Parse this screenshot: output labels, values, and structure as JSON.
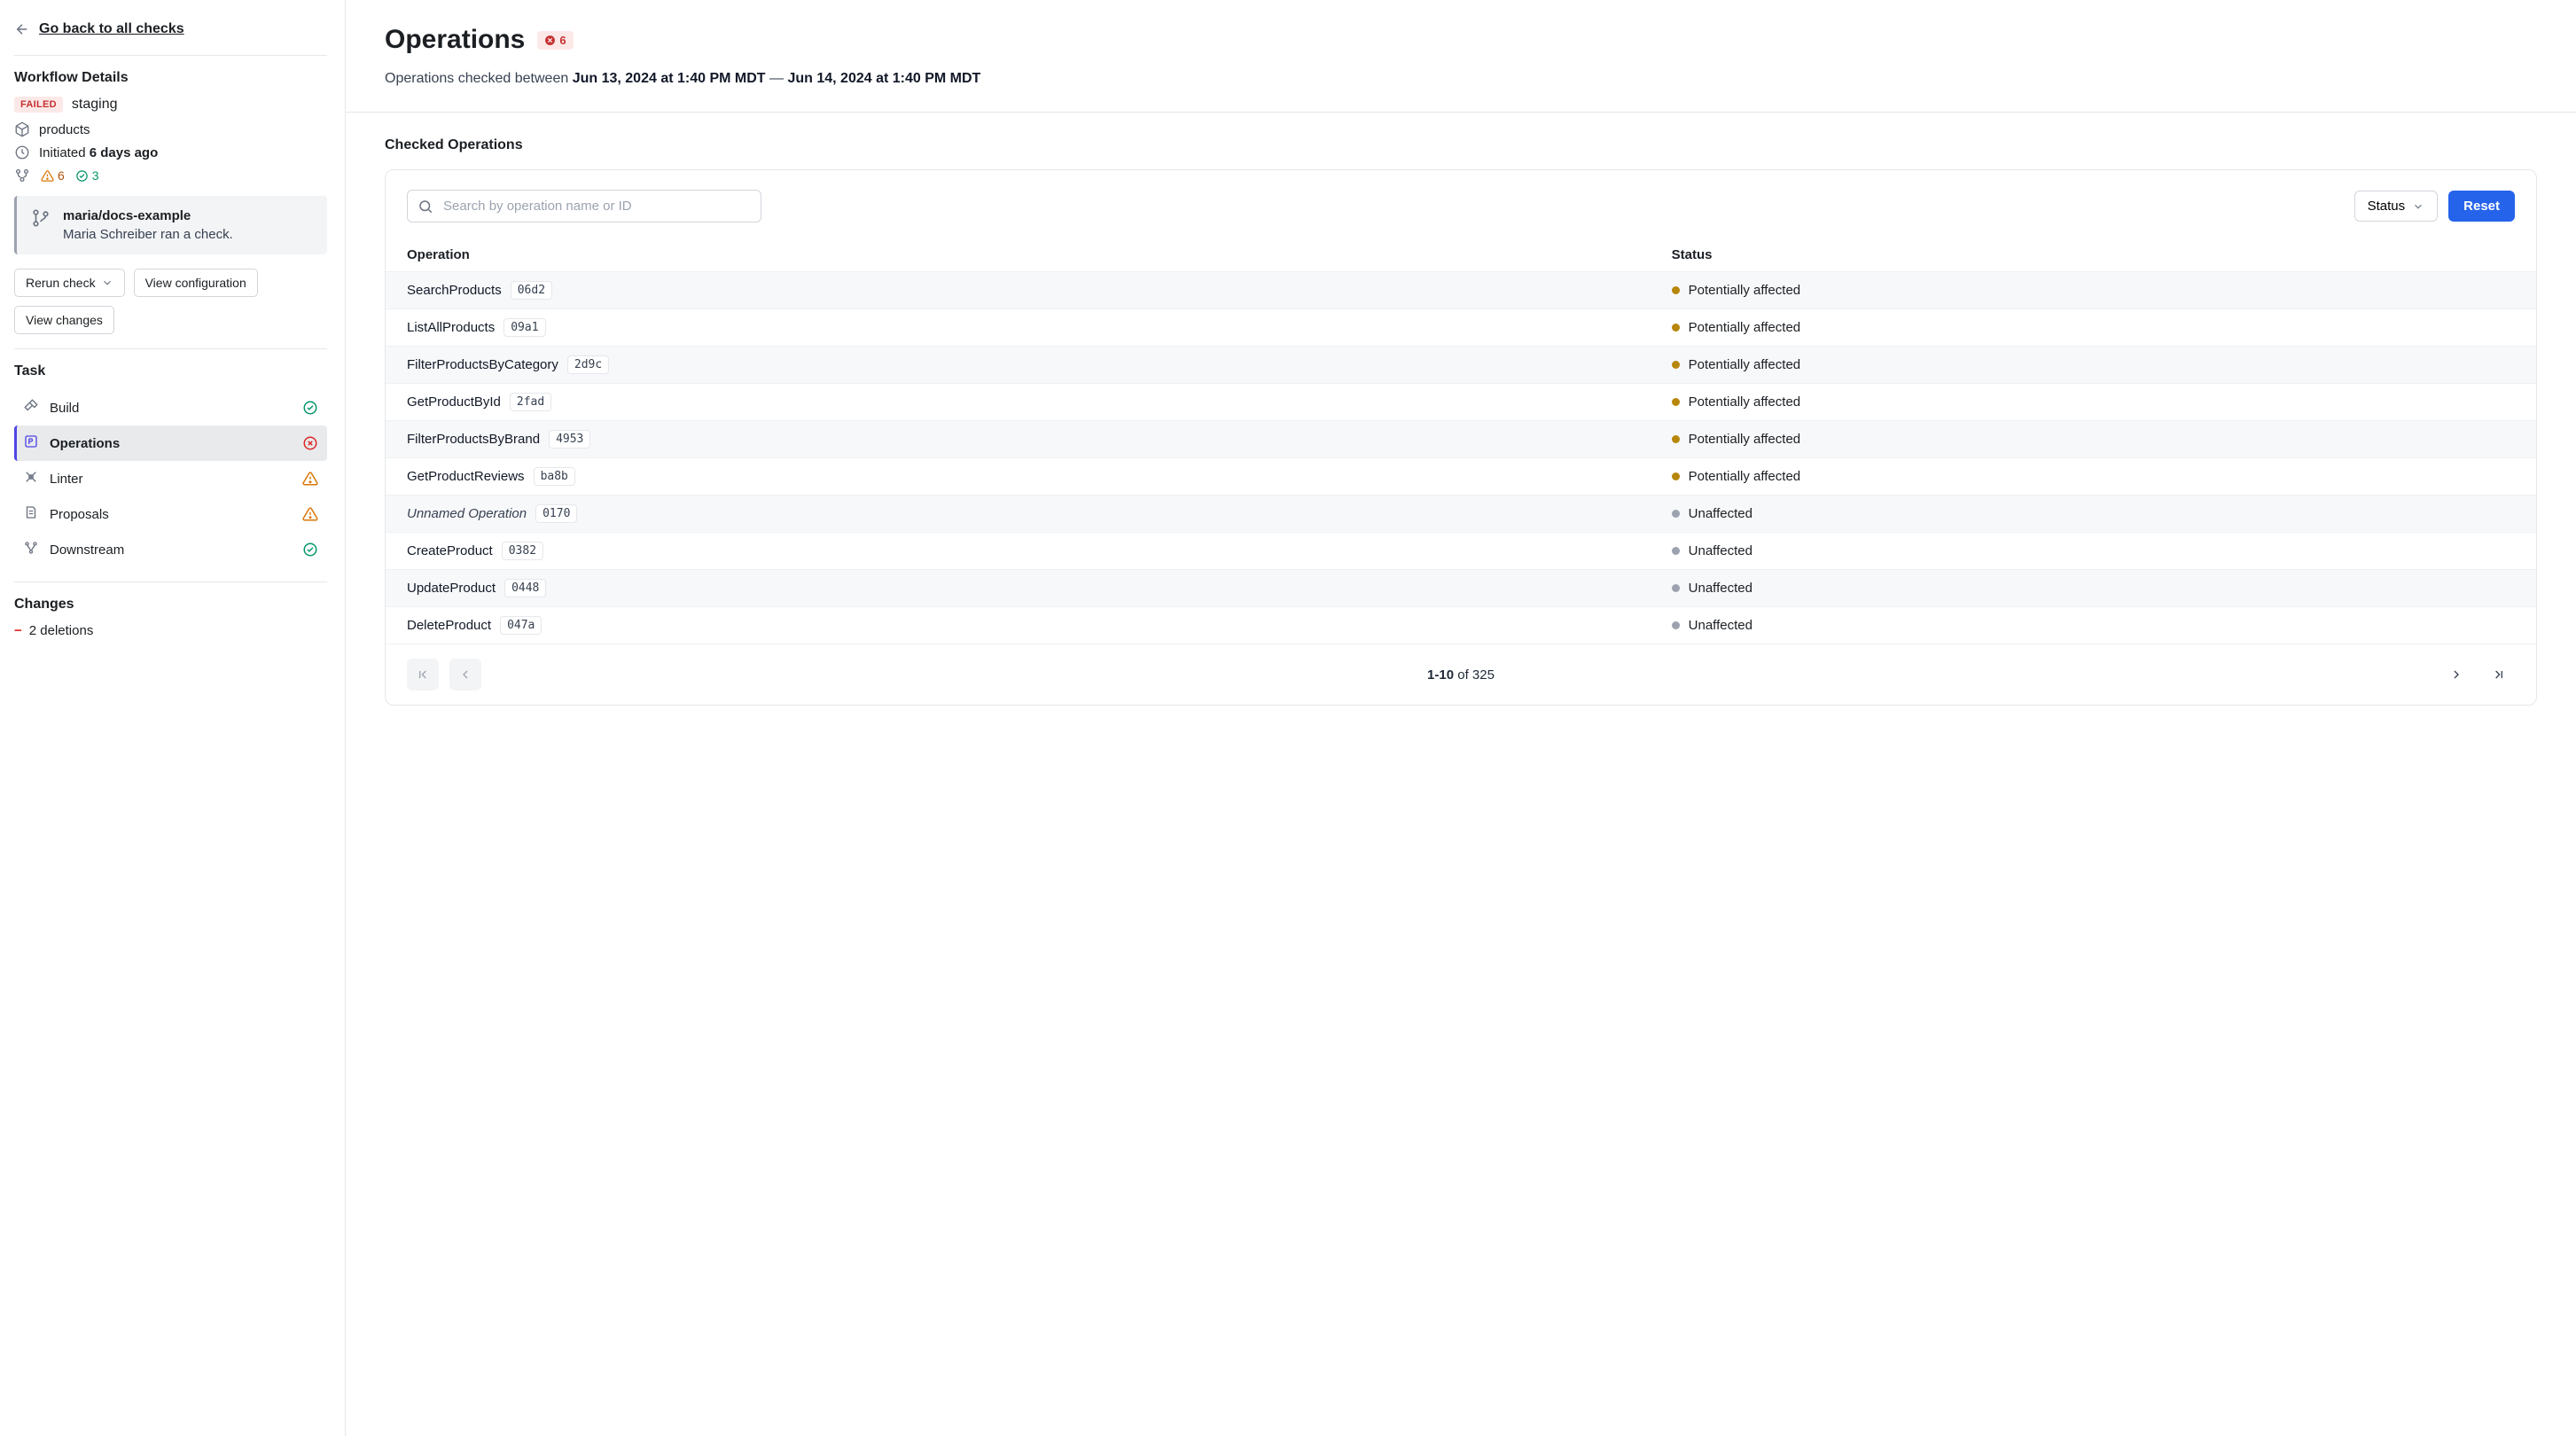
{
  "sidebar": {
    "back_link": "Go back to all checks",
    "workflow_details_title": "Workflow Details",
    "status_badge": "FAILED",
    "environment": "staging",
    "product": "products",
    "initiated_prefix": "Initiated",
    "initiated_rel": "6 days ago",
    "warn_count": "6",
    "ok_count": "3",
    "branch_name": "maria/docs-example",
    "branch_desc": "Maria Schreiber ran a check.",
    "btn_rerun": "Rerun check",
    "btn_view_config": "View configuration",
    "btn_view_changes": "View changes",
    "task_title": "Task",
    "tasks": [
      {
        "name": "Build",
        "status": "ok"
      },
      {
        "name": "Operations",
        "status": "error",
        "active": true
      },
      {
        "name": "Linter",
        "status": "warn"
      },
      {
        "name": "Proposals",
        "status": "warn"
      },
      {
        "name": "Downstream",
        "status": "ok"
      }
    ],
    "changes_title": "Changes",
    "changes_text": "2 deletions"
  },
  "header": {
    "title": "Operations",
    "badge_count": "6",
    "subtitle_prefix": "Operations checked between",
    "date_start": "Jun 13, 2024 at 1:40 PM MDT",
    "date_sep": " — ",
    "date_end": "Jun 14, 2024 at 1:40 PM MDT"
  },
  "ops": {
    "section_title": "Checked Operations",
    "search_placeholder": "Search by operation name or ID",
    "status_filter_label": "Status",
    "reset_label": "Reset",
    "col_operation": "Operation",
    "col_status": "Status",
    "rows": [
      {
        "name": "SearchProducts",
        "id": "06d2",
        "status": "Potentially affected",
        "dot": "warn"
      },
      {
        "name": "ListAllProducts",
        "id": "09a1",
        "status": "Potentially affected",
        "dot": "warn"
      },
      {
        "name": "FilterProductsByCategory",
        "id": "2d9c",
        "status": "Potentially affected",
        "dot": "warn"
      },
      {
        "name": "GetProductById",
        "id": "2fad",
        "status": "Potentially affected",
        "dot": "warn"
      },
      {
        "name": "FilterProductsByBrand",
        "id": "4953",
        "status": "Potentially affected",
        "dot": "warn"
      },
      {
        "name": "GetProductReviews",
        "id": "ba8b",
        "status": "Potentially affected",
        "dot": "warn"
      },
      {
        "name": "Unnamed Operation",
        "id": "0170",
        "status": "Unaffected",
        "dot": "neutral",
        "italic": true
      },
      {
        "name": "CreateProduct",
        "id": "0382",
        "status": "Unaffected",
        "dot": "neutral"
      },
      {
        "name": "UpdateProduct",
        "id": "0448",
        "status": "Unaffected",
        "dot": "neutral"
      },
      {
        "name": "DeleteProduct",
        "id": "047a",
        "status": "Unaffected",
        "dot": "neutral"
      }
    ],
    "pager": {
      "range": "1-10",
      "of_word": "of",
      "total": "325"
    }
  }
}
